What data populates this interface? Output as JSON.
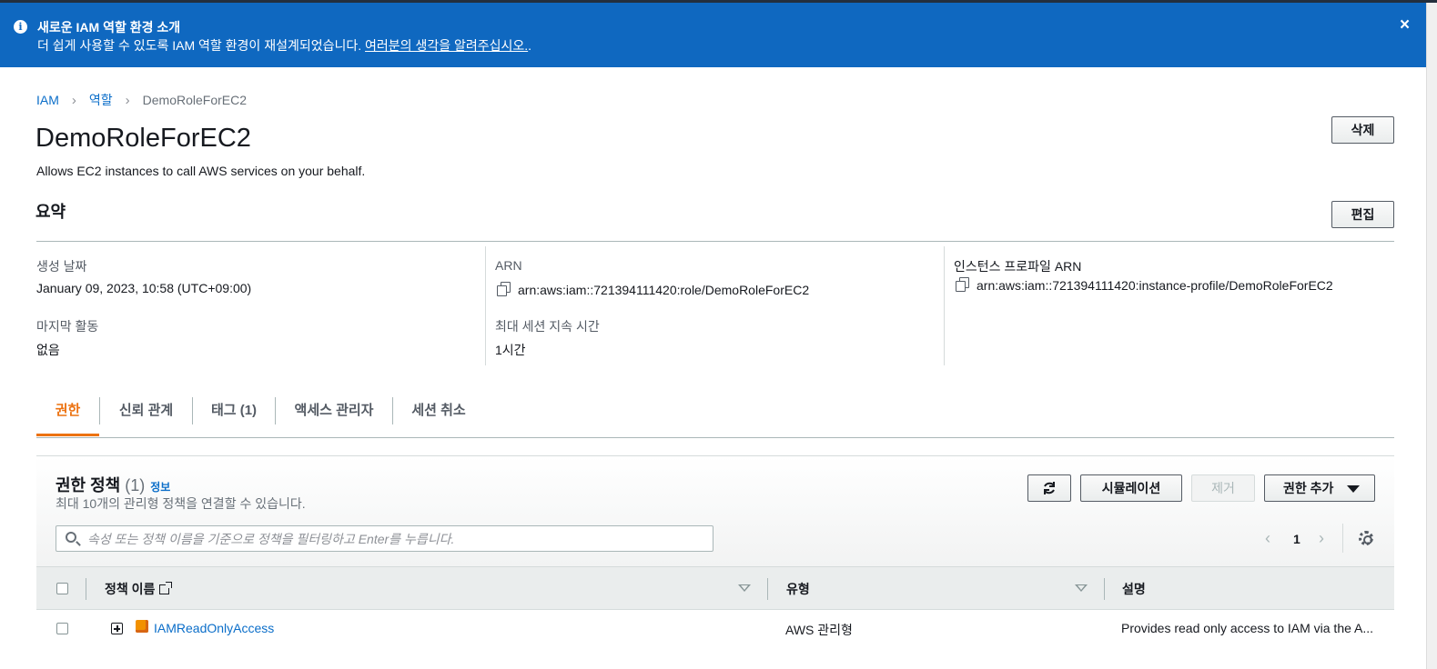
{
  "banner": {
    "title": "새로운 IAM 역할 환경 소개",
    "message": "더 쉽게 사용할 수 있도록 IAM 역할 환경이 재설계되었습니다. ",
    "link": "여러분의 생각을 알려주십시오.",
    "suffix": ".",
    "close": "×"
  },
  "breadcrumb": {
    "items": [
      "IAM",
      "역할"
    ],
    "current": "DemoRoleForEC2",
    "separator": "›"
  },
  "page": {
    "title": "DemoRoleForEC2",
    "description": "Allows EC2 instances to call AWS services on your behalf.",
    "delete_label": "삭제"
  },
  "summary": {
    "title": "요약",
    "edit_label": "편집",
    "created_label": "생성 날짜",
    "created_value": "January 09, 2023, 10:58 (UTC+09:00)",
    "last_activity_label": "마지막 활동",
    "last_activity_value": "없음",
    "arn_label": "ARN",
    "arn_value": "arn:aws:iam::721394111420:role/DemoRoleForEC2",
    "max_session_label": "최대 세션 지속 시간",
    "max_session_value": "1시간",
    "instance_profile_label": "인스턴스 프로파일 ARN",
    "instance_profile_value": "arn:aws:iam::721394111420:instance-profile/DemoRoleForEC2"
  },
  "tabs": [
    "권한",
    "신뢰 관계",
    "태그 (1)",
    "액세스 관리자",
    "세션 취소"
  ],
  "policies": {
    "title": "권한 정책",
    "count": "(1)",
    "info": "정보",
    "subtitle": "최대 10개의 관리형 정책을 연결할 수 있습니다.",
    "simulate_label": "시뮬레이션",
    "remove_label": "제거",
    "add_label": "권한 추가",
    "search_placeholder": "속성 또는 정책 이름을 기준으로 정책을 필터링하고 Enter를 누릅니다.",
    "page": "1",
    "columns": [
      "정책 이름",
      "유형",
      "설명"
    ],
    "rows": [
      {
        "name": "IAMReadOnlyAccess",
        "type": "AWS 관리형",
        "description": "Provides read only access to IAM via the A..."
      }
    ]
  },
  "colors": {
    "banner": "#0f68c0",
    "accent_tab": "#ec7211",
    "link": "#0b6ec9"
  }
}
